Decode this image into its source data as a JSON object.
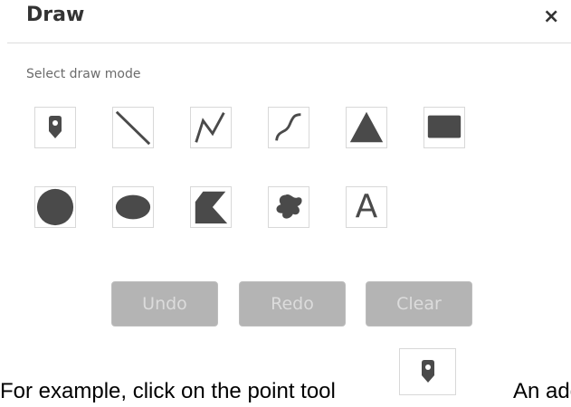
{
  "header": {
    "title": "Draw",
    "close_label": "×"
  },
  "mode": {
    "label": "Select draw mode"
  },
  "tools_row1": [
    {
      "name": "point-tool",
      "icon": "map-pin-icon"
    },
    {
      "name": "line-tool",
      "icon": "line-icon"
    },
    {
      "name": "polyline-tool",
      "icon": "polyline-icon"
    },
    {
      "name": "freehand-line-tool",
      "icon": "curve-icon"
    },
    {
      "name": "triangle-tool",
      "icon": "triangle-icon"
    },
    {
      "name": "rectangle-tool",
      "icon": "rectangle-icon"
    }
  ],
  "tools_row2": [
    {
      "name": "circle-tool",
      "icon": "circle-icon"
    },
    {
      "name": "ellipse-tool",
      "icon": "ellipse-icon"
    },
    {
      "name": "polygon-tool",
      "icon": "polygon-icon"
    },
    {
      "name": "freehand-polygon-tool",
      "icon": "freehand-polygon-icon"
    },
    {
      "name": "text-tool",
      "icon": "text-icon",
      "glyph": "A"
    }
  ],
  "actions": {
    "undo": "Undo",
    "redo": "Redo",
    "clear": "Clear"
  },
  "footer": {
    "text_before": "For example, click on the point tool",
    "text_after": "An addi",
    "icon": "map-pin-icon"
  },
  "colors": {
    "icon": "#4a4a4a",
    "button_bg": "#b4b4b4",
    "button_text": "#dcdcdc",
    "tool_border": "#d8d8d8"
  }
}
